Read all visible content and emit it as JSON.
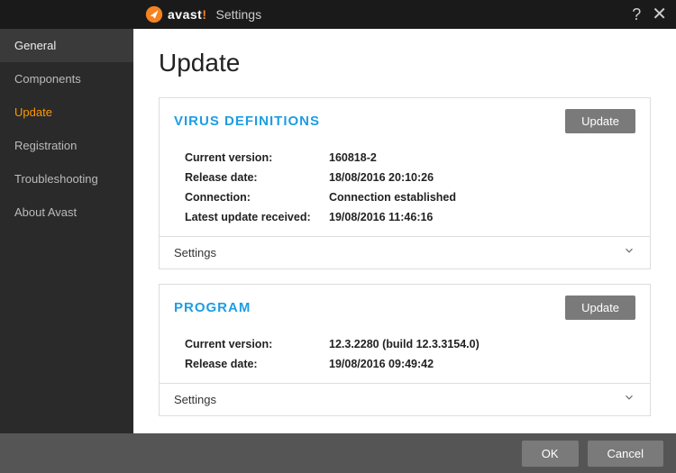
{
  "header": {
    "brand": "avast",
    "title": "Settings"
  },
  "sidebar": {
    "items": [
      {
        "label": "General"
      },
      {
        "label": "Components"
      },
      {
        "label": "Update"
      },
      {
        "label": "Registration"
      },
      {
        "label": "Troubleshooting"
      },
      {
        "label": "About Avast"
      }
    ]
  },
  "page": {
    "title": "Update"
  },
  "virus_defs": {
    "title": "VIRUS DEFINITIONS",
    "update_btn": "Update",
    "rows": {
      "current_version_label": "Current version:",
      "current_version_value": "160818-2",
      "release_date_label": "Release date:",
      "release_date_value": "18/08/2016 20:10:26",
      "connection_label": "Connection:",
      "connection_value": "Connection established",
      "latest_update_label": "Latest update received:",
      "latest_update_value": "19/08/2016 11:46:16"
    },
    "settings_label": "Settings"
  },
  "program": {
    "title": "PROGRAM",
    "update_btn": "Update",
    "rows": {
      "current_version_label": "Current version:",
      "current_version_value": "12.3.2280 (build 12.3.3154.0)",
      "release_date_label": "Release date:",
      "release_date_value": "19/08/2016 09:49:42"
    },
    "settings_label": "Settings"
  },
  "footer": {
    "ok": "OK",
    "cancel": "Cancel"
  }
}
